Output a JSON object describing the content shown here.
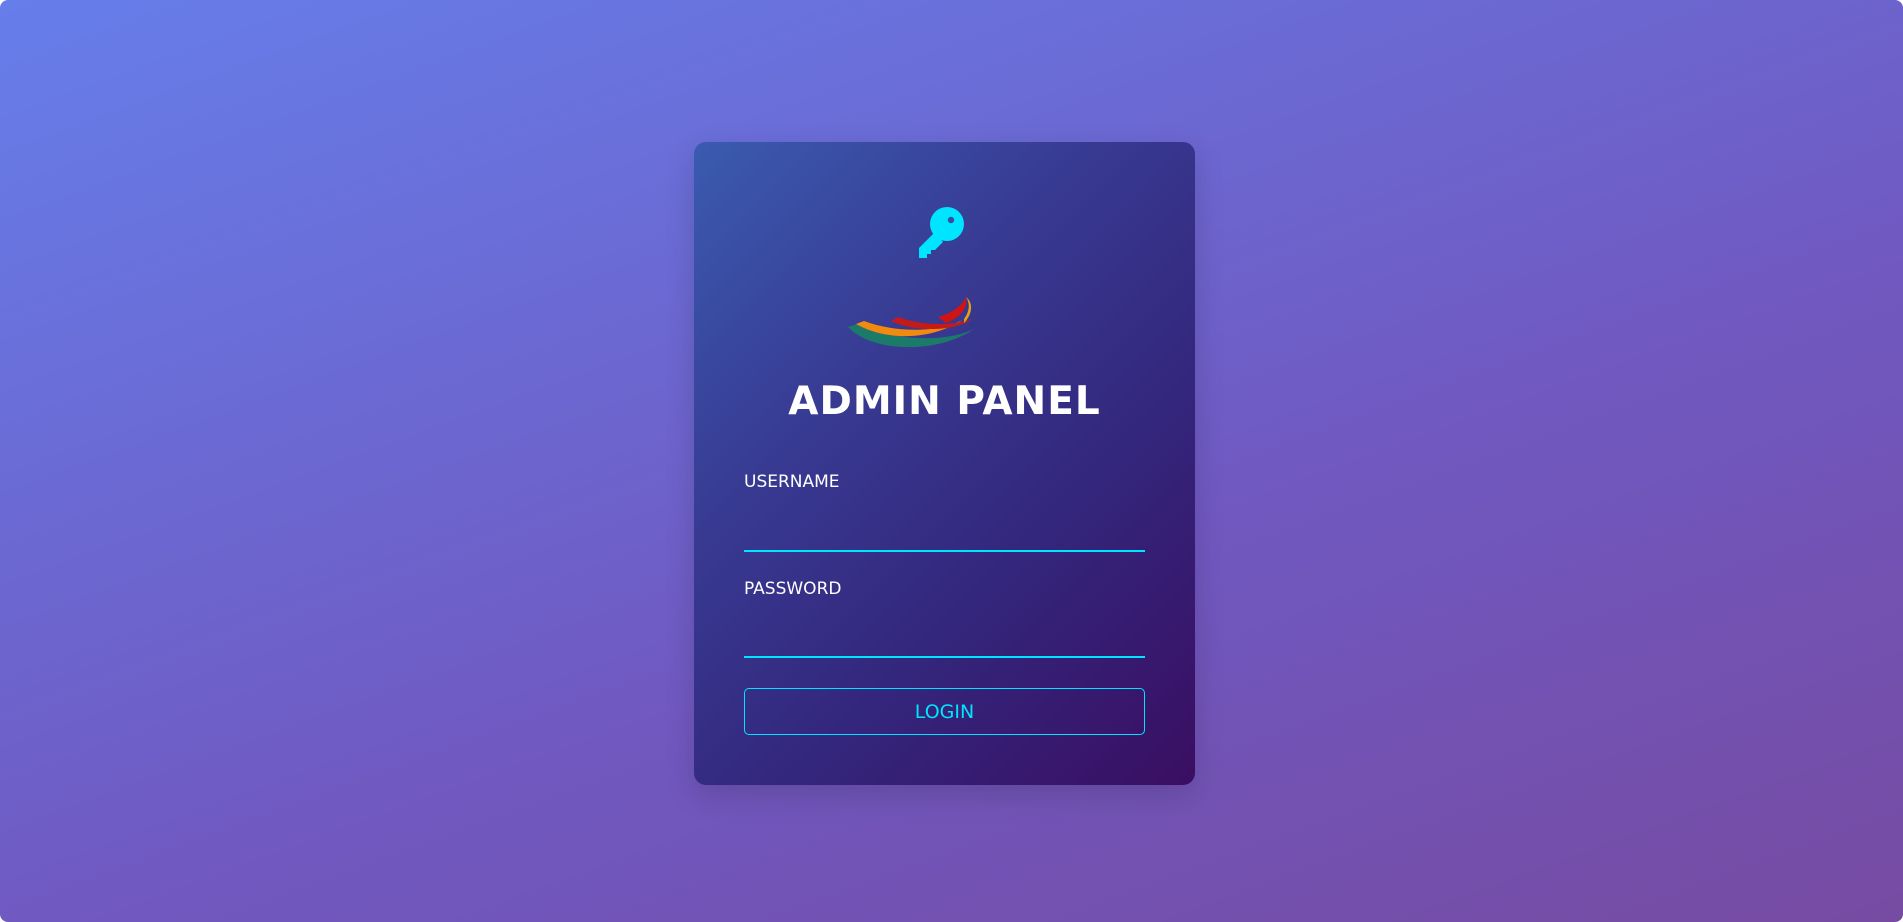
{
  "colors": {
    "background_start": "#667eea",
    "background_end": "#764ba2",
    "card_start": "#3a5bb0",
    "card_end": "#3a0e62",
    "accent": "#00e5ff",
    "text": "#ffffff"
  },
  "icons": {
    "key": "key-icon",
    "logo": "brand-logo"
  },
  "panel": {
    "title": "ADMIN PANEL"
  },
  "form": {
    "username_label": "USERNAME",
    "username_value": "",
    "password_label": "PASSWORD",
    "password_value": "",
    "login_label": "LOGIN"
  }
}
